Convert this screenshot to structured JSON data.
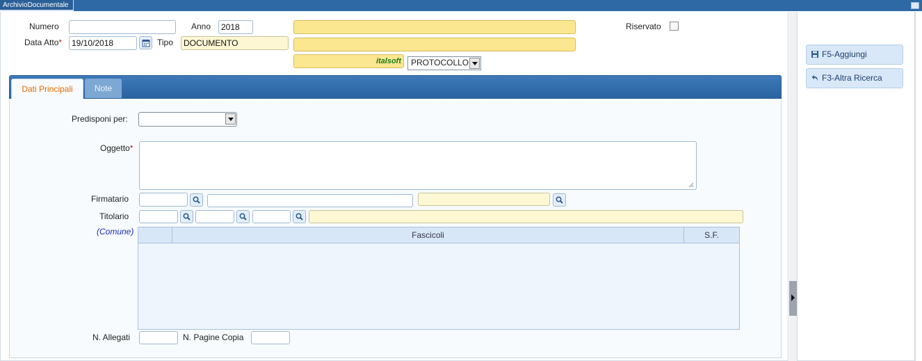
{
  "window": {
    "title": "ArchivioDocumentale"
  },
  "header": {
    "numero_label": "Numero",
    "numero_value": "",
    "anno_label": "Anno",
    "anno_value": "2018",
    "data_atto_label": "Data Atto",
    "required_mark": "*",
    "data_atto_value": "19/10/2018",
    "tipo_label": "Tipo",
    "tipo_value": "DOCUMENTO",
    "riservato_label": "Riservato",
    "italsoft_text": "italsoft",
    "protocollo_value": "PROTOCOLLO"
  },
  "tabs": [
    {
      "label": "Dati Principali",
      "active": true
    },
    {
      "label": "Note",
      "active": false
    }
  ],
  "form": {
    "predisponi_label": "Predisponi per:",
    "predisponi_value": "",
    "oggetto_label": "Oggetto",
    "firmatario_label": "Firmatario",
    "titolario_label": "Titolario",
    "comune_label": "(Comune)",
    "n_allegati_label": "N. Allegati",
    "n_pagine_copia_label": "N. Pagine Copia"
  },
  "grid": {
    "columns": [
      "",
      "Fascicoli",
      "S.F."
    ],
    "rows": []
  },
  "actions": [
    {
      "label": "F5-Aggiungi",
      "icon": "save-icon"
    },
    {
      "label": "F3-Altra Ricerca",
      "icon": "back-arrow-icon"
    }
  ],
  "colors": {
    "header_blue": "#2e69a6",
    "active_tab_text": "#e06c00",
    "required": "#c0181b",
    "italsoft_green": "#1a7a1a",
    "comune_blue": "#1b2bbf",
    "gold_field": "#fbe78f",
    "yellow_field": "#fdf7d3"
  }
}
